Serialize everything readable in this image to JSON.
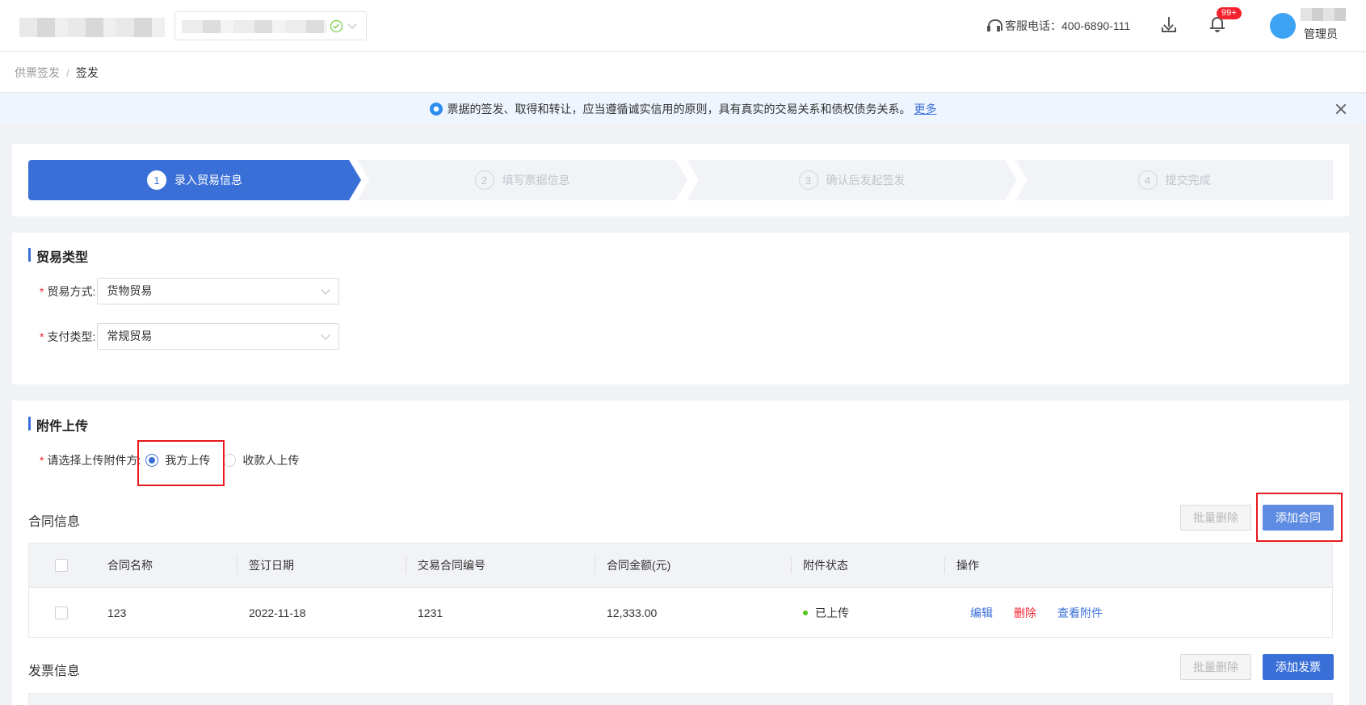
{
  "header": {
    "hotline": "客服电话：400-6890-111",
    "notification_badge": "99+",
    "user_role": "管理员"
  },
  "breadcrumb": {
    "parent": "供票签发",
    "separator": "/",
    "current": "签发"
  },
  "notice": {
    "text": "票据的签发、取得和转让，应当遵循诚实信用的原则，具有真实的交易关系和债权债务关系。",
    "more": "更多"
  },
  "steps": [
    {
      "num": "1",
      "label": "录入贸易信息",
      "active": true
    },
    {
      "num": "2",
      "label": "填写票据信息",
      "active": false
    },
    {
      "num": "3",
      "label": "确认后发起签发",
      "active": false
    },
    {
      "num": "4",
      "label": "提交完成",
      "active": false
    }
  ],
  "trade": {
    "title": "贸易类型",
    "method_label": "贸易方式:",
    "method_value": "货物贸易",
    "payment_label": "支付类型:",
    "payment_value": "常规贸易"
  },
  "attachment": {
    "title": "附件上传",
    "uploader_label": "请选择上传附件方:",
    "options": [
      "我方上传",
      "收款人上传"
    ],
    "selected": "我方上传"
  },
  "contract": {
    "title": "合同信息",
    "batch_delete": "批量删除",
    "add": "添加合同",
    "columns": [
      "合同名称",
      "签订日期",
      "交易合同编号",
      "合同金额(元)",
      "附件状态",
      "操作"
    ],
    "rows": [
      {
        "name": "123",
        "date": "2022-11-18",
        "number": "1231",
        "amount": "12,333.00",
        "status": "已上传",
        "actions": [
          "编辑",
          "删除",
          "查看附件"
        ]
      }
    ]
  },
  "invoice": {
    "title": "发票信息",
    "batch_delete": "批量删除",
    "add": "添加发票"
  },
  "colors": {
    "primary": "#3a6fd8",
    "danger": "#f5222d",
    "success": "#52c41a",
    "highlight": "#e8191e"
  }
}
